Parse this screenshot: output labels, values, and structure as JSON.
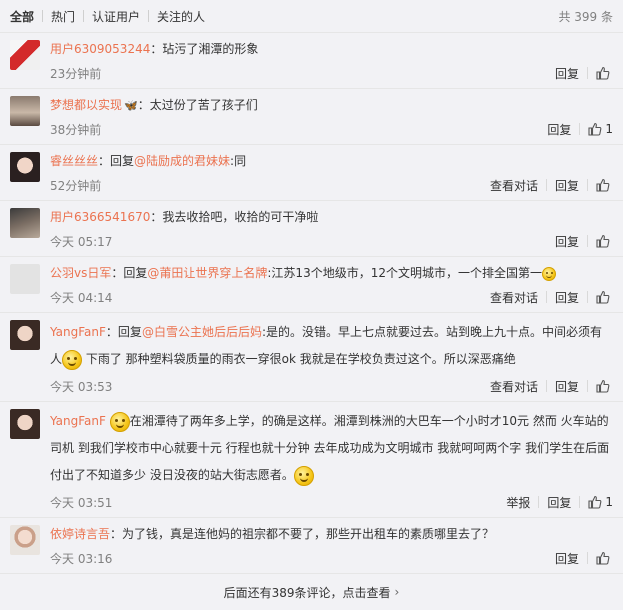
{
  "tabs": [
    "全部",
    "热门",
    "认证用户",
    "关注的人"
  ],
  "count_text": "共 399 条",
  "colors": {
    "accent": "#eb7350",
    "bg": "#f2f2f5"
  },
  "comments": [
    {
      "user": "用户6309053244",
      "content": "：玷污了湘潭的形象",
      "time": "23分钟前",
      "actions": [
        "回复"
      ],
      "likes": ""
    },
    {
      "user": "梦想都以实现",
      "badge": "butterfly-icon",
      "content": "：太过份了苦了孩子们",
      "time": "38分钟前",
      "actions": [
        "回复"
      ],
      "likes": "1"
    },
    {
      "user": "睿丝丝丝",
      "reply_prefix": "：回复",
      "mention": "@陆励成的君妹妹",
      "content": ":同",
      "time": "52分钟前",
      "actions": [
        "查看对话",
        "回复"
      ],
      "likes": ""
    },
    {
      "user": "用户6366541670",
      "content": "：我去收拾吧，收拾的可干净啦",
      "time": "今天 05:17",
      "actions": [
        "回复"
      ],
      "likes": ""
    },
    {
      "user": "公羽vs日军",
      "reply_prefix": "：回复",
      "mention": "@莆田让世界穿上名牌",
      "content": ":江苏13个地级市，12个文明城市，一个排全国第一",
      "time": "今天 04:14",
      "actions": [
        "查看对话",
        "回复"
      ],
      "likes": ""
    },
    {
      "user": "YangFanF",
      "reply_prefix": "：回复",
      "mention": "@白雪公主她后后后妈",
      "content_a": ":是的。没错。早上七点就要过去。站到晚上九十点。中间必须有人",
      "content_b": " 下雨了 那种塑料袋质量的雨衣一穿很ok 我就是在学校负责过这个。所以深恶痛绝",
      "time": "今天 03:53",
      "actions": [
        "查看对话",
        "回复"
      ],
      "likes": ""
    },
    {
      "user": "YangFanF",
      "content_a": "在湘潭待了两年多上学，的确是这样。湘潭到株洲的大巴车一个小时才10元 然而 火车站的司机 到我们学校市中心就要十元 行程也就十分钟 去年成功成为文明城市 我就呵呵两个字 我们学生在后面付出了不知道多少 没日没夜的站大街志愿者。",
      "time": "今天 03:51",
      "actions": [
        "举报",
        "回复"
      ],
      "likes": "1"
    },
    {
      "user": "依婷诗言吾",
      "content": "：为了钱，真是连他妈的祖宗都不要了，那些开出租车的素质哪里去了？",
      "time": "今天 03:16",
      "actions": [
        "回复"
      ],
      "likes": ""
    }
  ],
  "footer_text": "后面还有389条评论，点击查看",
  "icons": {
    "like": "thumbs-up-icon",
    "more": "chevron-right-icon"
  }
}
